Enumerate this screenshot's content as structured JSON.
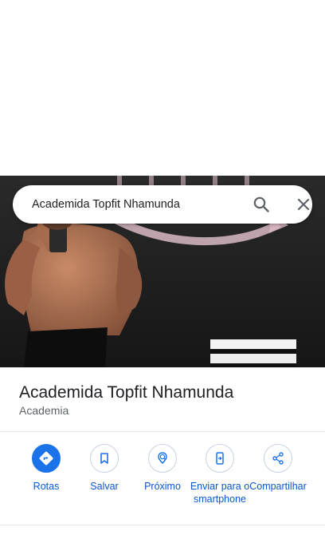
{
  "search": {
    "query": "Academida Topfit Nhamunda"
  },
  "place": {
    "name": "Academida Topfit Nhamunda",
    "category": "Academia"
  },
  "actions": [
    {
      "label": "Rotas",
      "icon": "directions-icon"
    },
    {
      "label": "Salvar",
      "icon": "bookmark-icon"
    },
    {
      "label": "Próximo",
      "icon": "nearby-icon"
    },
    {
      "label": "Enviar para o smartphone",
      "icon": "send-to-phone-icon"
    },
    {
      "label": "Compartilhar",
      "icon": "share-icon"
    }
  ],
  "colors": {
    "accent": "#1a73e8",
    "label": "#0b57d0",
    "title": "#202124",
    "subtitle": "#5f6368"
  }
}
